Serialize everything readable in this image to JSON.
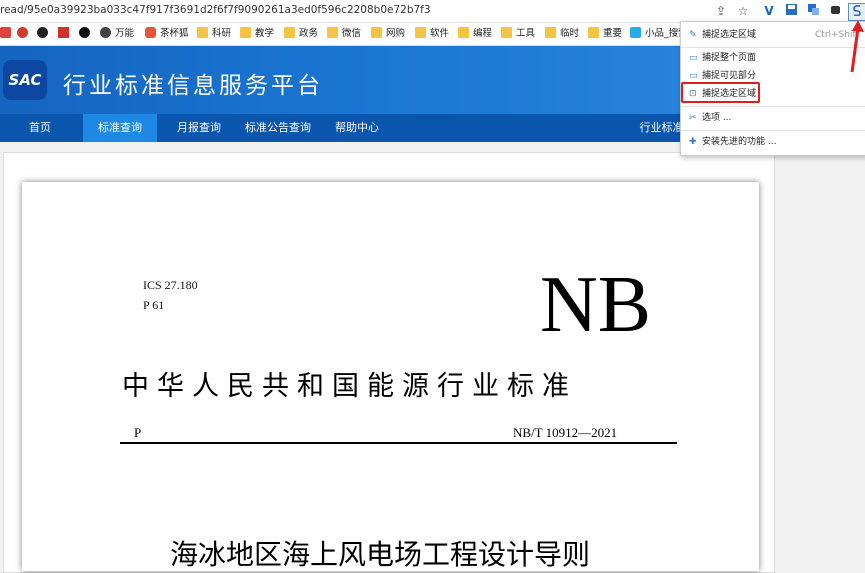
{
  "browser": {
    "url": "read/95e0a39923ba033c47f917f3691d2f6f7f9090261a3ed0f596c2208b0e72b7f3"
  },
  "bookmarks": [
    {
      "label": "",
      "icon": "app-icon"
    },
    {
      "label": "",
      "icon": "media-icon"
    },
    {
      "label": "",
      "icon": "grid-icon"
    },
    {
      "label": "",
      "icon": "github-icon"
    },
    {
      "label": "万能",
      "icon": "globe-icon"
    },
    {
      "label": "茶杯狐",
      "icon": "cup-icon"
    },
    {
      "label": "科研",
      "icon": "folder-icon"
    },
    {
      "label": "教学",
      "icon": "folder-icon"
    },
    {
      "label": "政务",
      "icon": "folder-icon"
    },
    {
      "label": "微信",
      "icon": "folder-icon"
    },
    {
      "label": "网购",
      "icon": "folder-icon"
    },
    {
      "label": "软件",
      "icon": "folder-icon"
    },
    {
      "label": "编程",
      "icon": "folder-icon"
    },
    {
      "label": "工具",
      "icon": "folder-icon"
    },
    {
      "label": "临时",
      "icon": "folder-icon"
    },
    {
      "label": "重要",
      "icon": "folder-icon"
    },
    {
      "label": "小品_搜索",
      "icon": "bilibili-icon"
    }
  ],
  "site": {
    "logo": "SAC",
    "title": "行业标准信息服务平台",
    "nav": [
      "首页",
      "标准查询",
      "月报查询",
      "标准公告查询",
      "帮助中心",
      "行业标准备"
    ],
    "active_nav": "标准查询"
  },
  "document": {
    "ics": "ICS 27.180",
    "classification": "P 61",
    "code": "NB",
    "issuer": "中华人民共和国能源行业标准",
    "p_label": "P",
    "number": "NB/T 10912—2021",
    "title": "海冰地区海上风电场工程设计导则"
  },
  "menu": {
    "items": [
      {
        "label": "捕捉选定区域",
        "shortcut": "Ctrl+Shift",
        "icon": "pen-icon"
      },
      {
        "label": "捕捉整个页面",
        "icon": "page-icon"
      },
      {
        "label": "捕捉可见部分",
        "icon": "page-icon"
      },
      {
        "label": "捕捉选定区域",
        "icon": "crop-icon",
        "highlighted": true
      },
      {
        "label": "选项 ...",
        "icon": "tools-icon"
      },
      {
        "label": "安装先进的功能 ...",
        "icon": "plus-icon"
      }
    ]
  },
  "colors": {
    "header_blue": "#1976d2",
    "nav_blue": "#0a55ad",
    "active_tab": "#1e88e5",
    "highlight_red": "#e21d1d"
  }
}
